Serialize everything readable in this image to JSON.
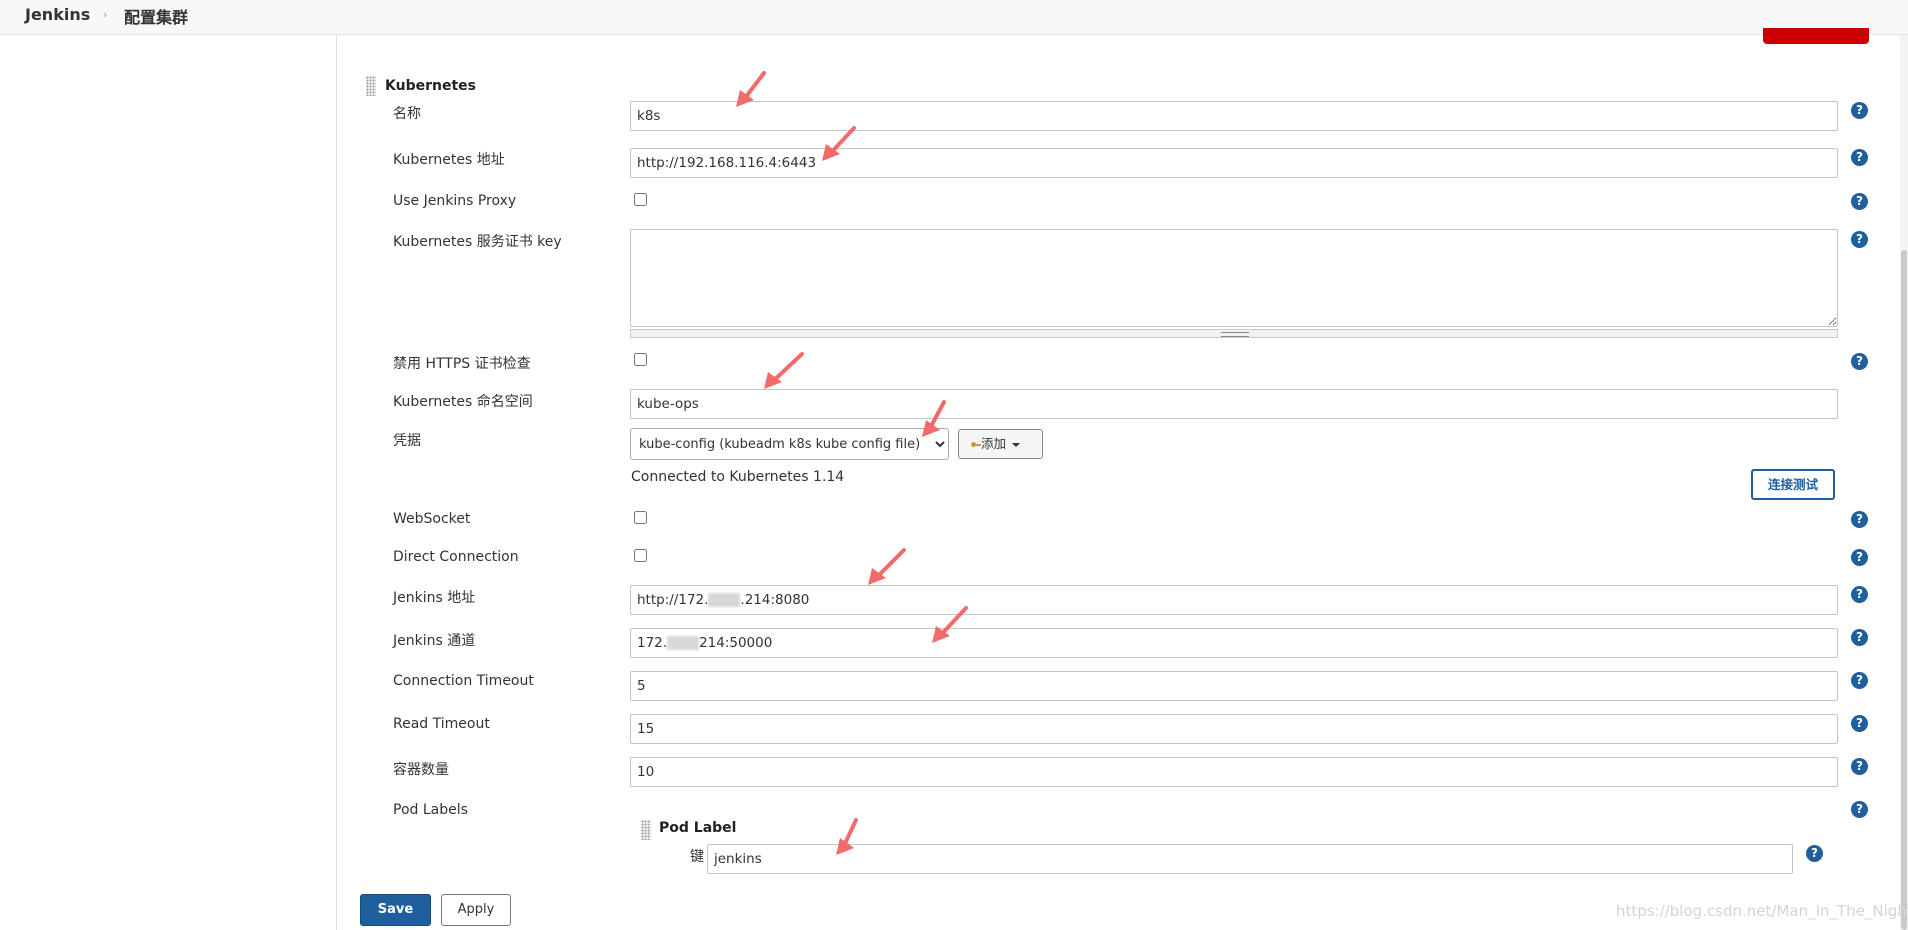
{
  "breadcrumb": {
    "home": "Jenkins",
    "separator": "›",
    "page": "配置集群"
  },
  "section": {
    "title": "Kubernetes"
  },
  "fields": {
    "name": {
      "label": "名称",
      "value": "k8s"
    },
    "k8s_url": {
      "label": "Kubernetes 地址",
      "value": "http://192.168.116.4:6443"
    },
    "use_proxy": {
      "label": "Use Jenkins Proxy"
    },
    "server_cert": {
      "label": "Kubernetes 服务证书 key"
    },
    "disable_https": {
      "label": "禁用 HTTPS 证书检查"
    },
    "namespace": {
      "label": "Kubernetes 命名空间",
      "value": "kube-ops"
    },
    "credentials": {
      "label": "凭据",
      "selected": "kube-config (kubeadm k8s kube config file)",
      "add_label": "添加"
    },
    "status": {
      "text": "Connected to Kubernetes 1.14",
      "test_label": "连接测试"
    },
    "websocket": {
      "label": "WebSocket"
    },
    "direct_connection": {
      "label": "Direct Connection"
    },
    "jenkins_url": {
      "label": "Jenkins 地址",
      "prefix": "http://172.",
      "suffix": ".214:8080"
    },
    "jenkins_tunnel": {
      "label": "Jenkins 通道",
      "prefix": "172.",
      "suffix": "214:50000"
    },
    "connection_timeout": {
      "label": "Connection Timeout",
      "value": "5"
    },
    "read_timeout": {
      "label": "Read Timeout",
      "value": "15"
    },
    "container_cap": {
      "label": "容器数量",
      "value": "10"
    },
    "pod_labels": {
      "label": "Pod Labels"
    }
  },
  "pod_label": {
    "title": "Pod Label",
    "key_label": "键",
    "key_value": "jenkins"
  },
  "help_glyph": "?",
  "buttons": {
    "save": "Save",
    "apply": "Apply"
  },
  "watermark": "https://blog.csdn.net/Man_In_The_Night",
  "colors": {
    "primary": "#1f5f9d",
    "danger": "#cc0000",
    "annotation_arrow": "#f26b6b"
  },
  "icons": {
    "help": "help-icon",
    "key": "key-icon",
    "caret": "caret-down-icon",
    "drag": "drag-handle-icon",
    "annotation": "arrow-annotation-icon"
  }
}
